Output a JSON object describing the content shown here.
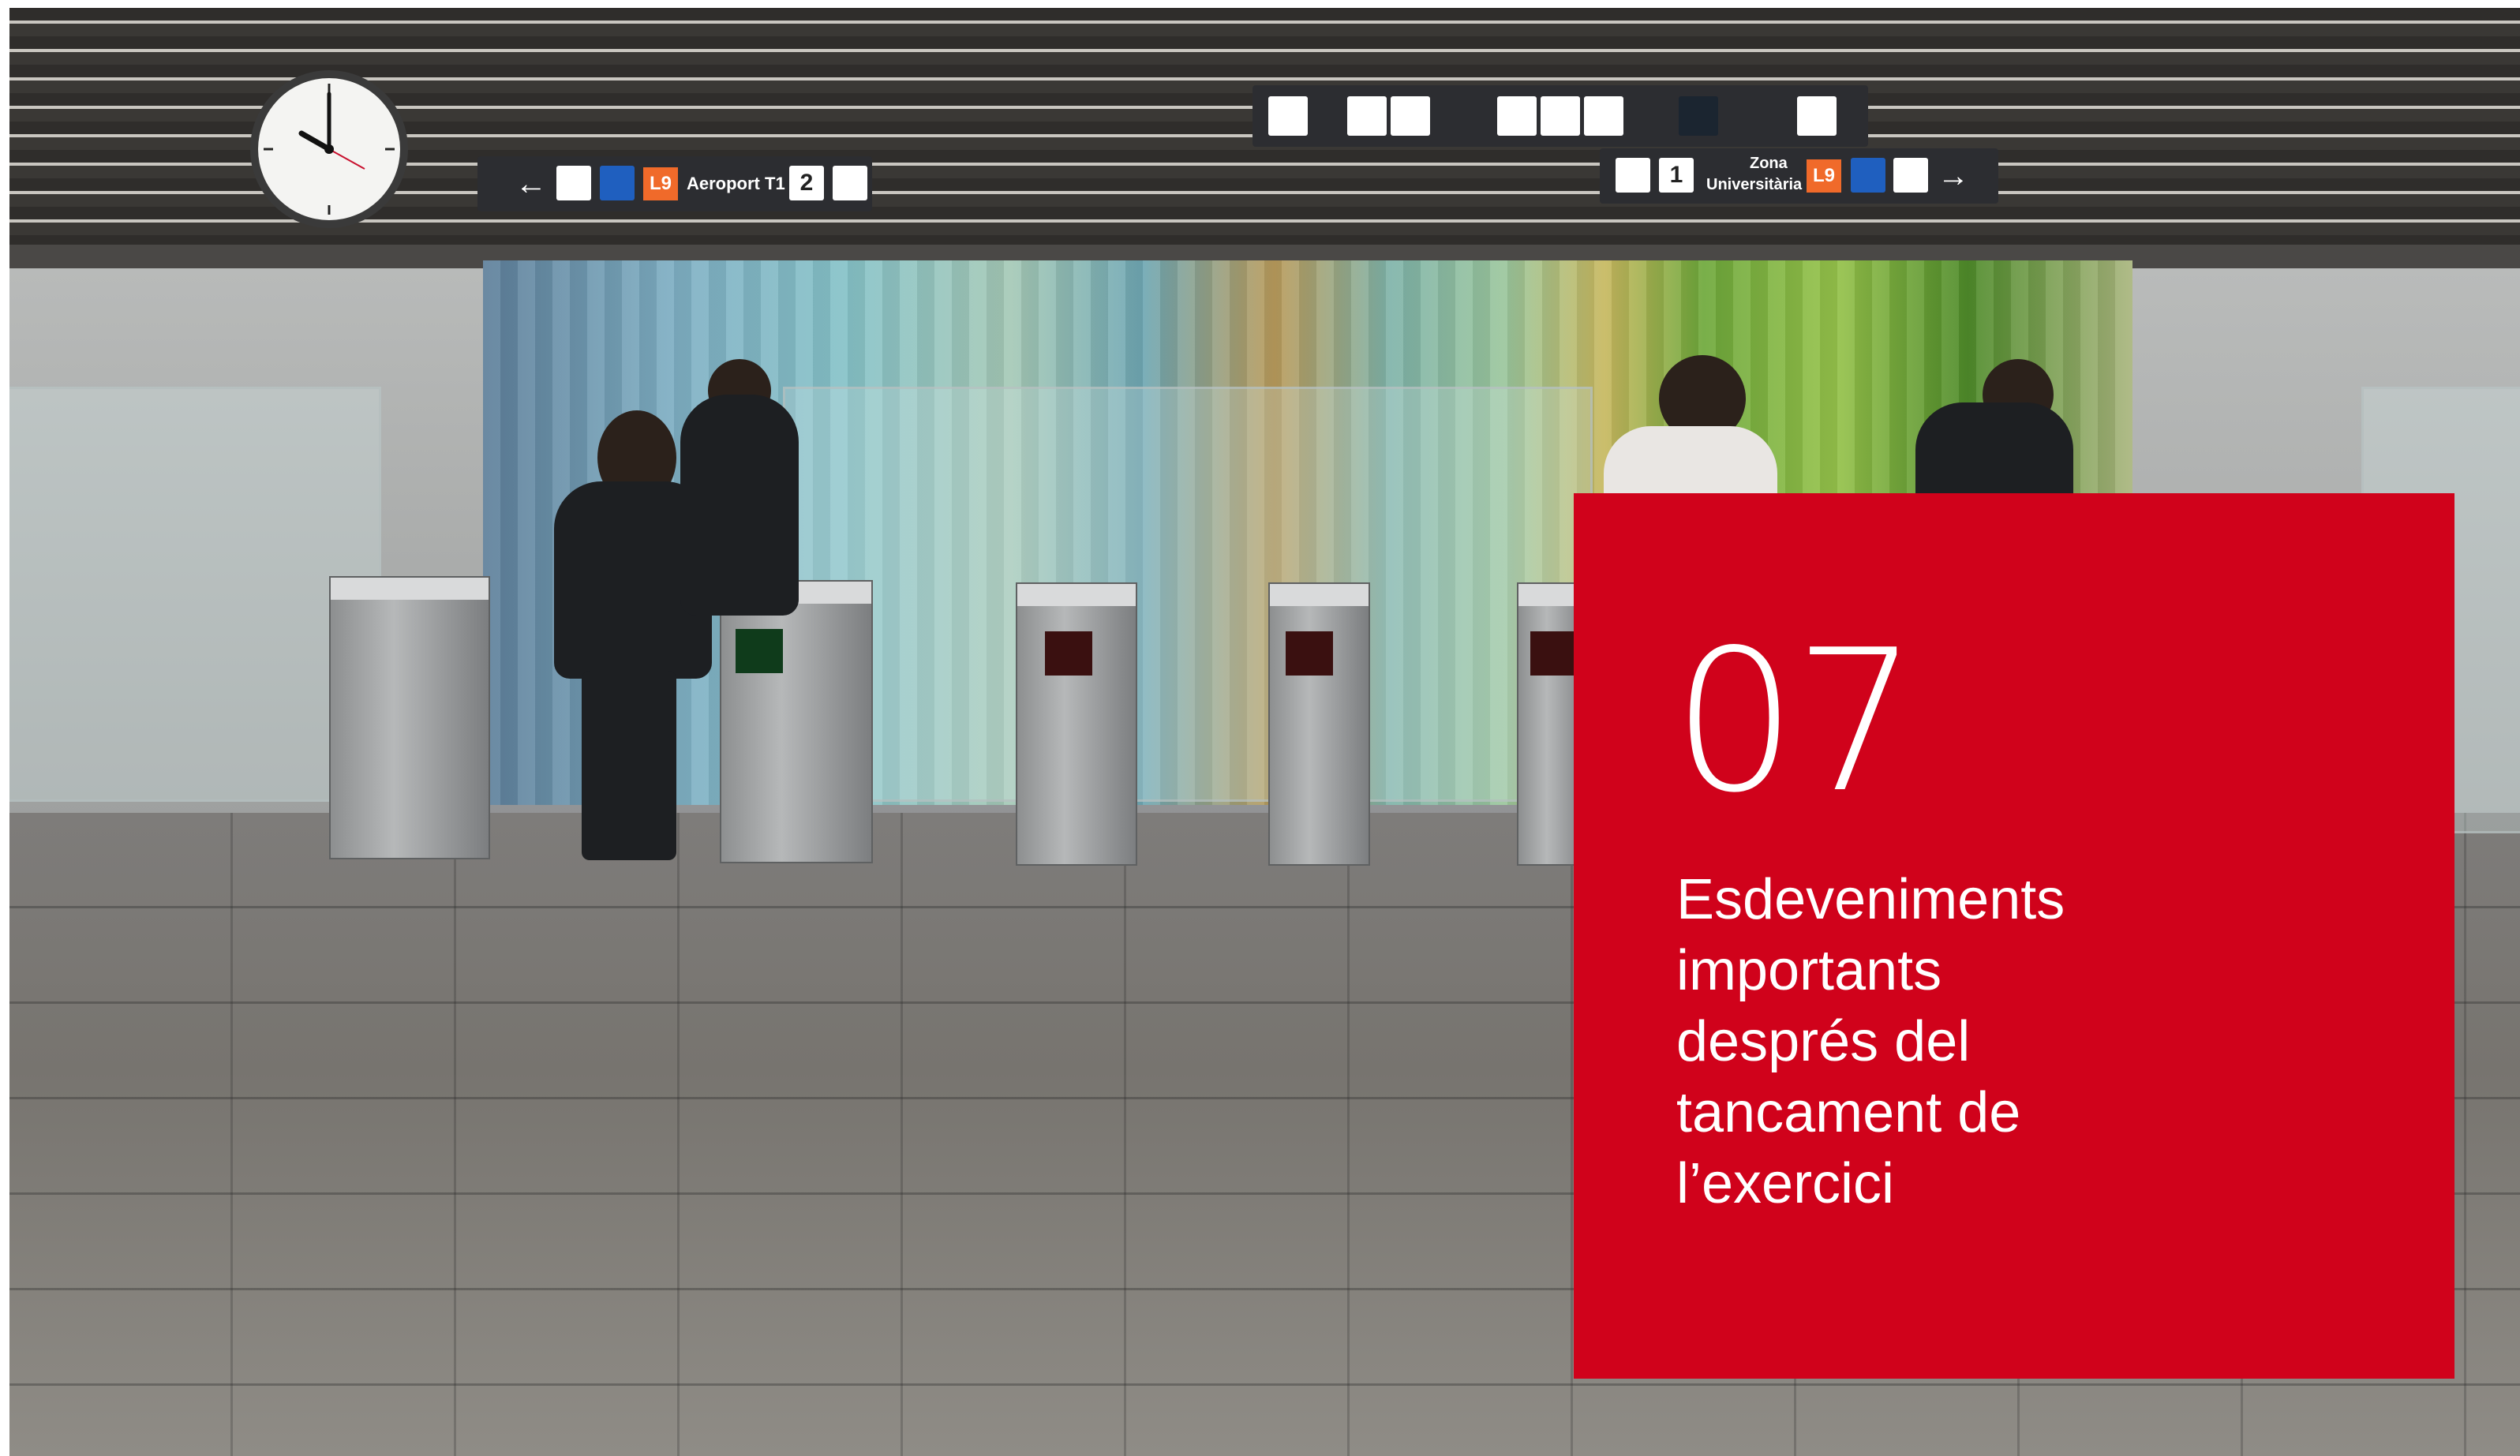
{
  "chapter": {
    "number": "07",
    "title_lines": [
      "Esdeveniments",
      "importants",
      "després del",
      "tancament de",
      "l’exercici"
    ]
  },
  "photo": {
    "left_sign": {
      "l9_label": "L9",
      "destination": "Aeroport T1",
      "via_number": "2"
    },
    "right_sign": {
      "via_number": "1",
      "destination_line1": "Zona",
      "destination_line2": "Universitària",
      "l9_label": "L9"
    },
    "colors": {
      "panel": "#d0021b",
      "l9_badge": "#f06a2a"
    }
  }
}
